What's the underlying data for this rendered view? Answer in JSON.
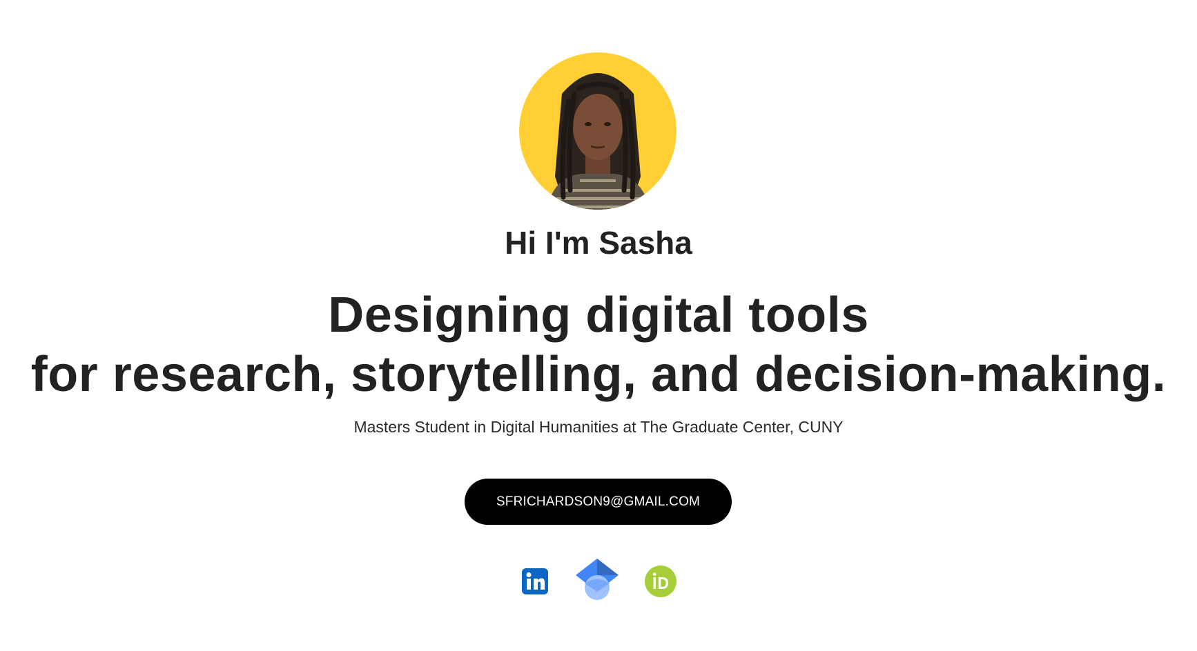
{
  "profile": {
    "greeting": "Hi I'm Sasha",
    "headline_line1": "Designing digital tools",
    "headline_line2": "for research, storytelling, and decision-making.",
    "subtitle": "Masters Student in Digital Humanities at The Graduate Center, CUNY",
    "avatar_background": "#FFCF33"
  },
  "contact": {
    "email_label": "SFRICHARDSON9@GMAIL.COM"
  },
  "socials": [
    {
      "icon": "linkedin-icon",
      "color": "#0A66C2"
    },
    {
      "icon": "google-scholar-icon",
      "color": "#4285F4"
    },
    {
      "icon": "orcid-icon",
      "color": "#A6CE39"
    }
  ]
}
